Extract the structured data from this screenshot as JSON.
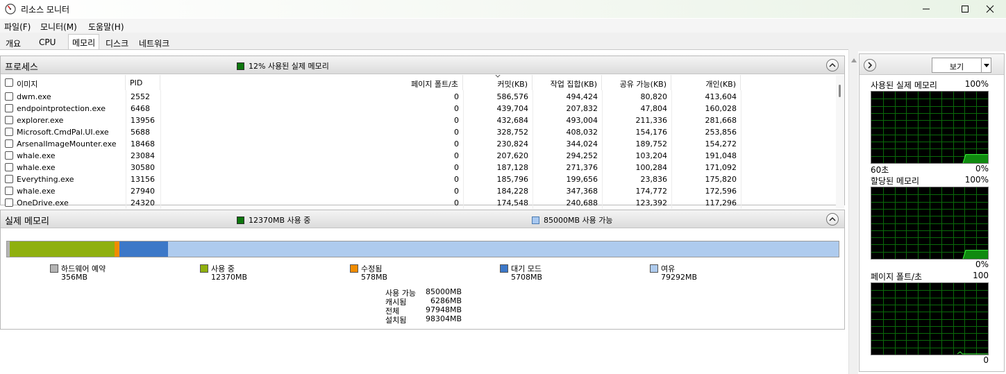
{
  "window": {
    "title": "리소스 모니터",
    "controls": {
      "minimize": "minimize-icon",
      "maximize": "maximize-icon",
      "close": "close-icon"
    }
  },
  "menu": [
    "파일(F)",
    "모니터(M)",
    "도움말(H)"
  ],
  "tabs": [
    {
      "label": "개요",
      "active": false
    },
    {
      "label": "CPU",
      "active": false
    },
    {
      "label": "메모리",
      "active": true
    },
    {
      "label": "디스크",
      "active": false
    },
    {
      "label": "네트워크",
      "active": false
    }
  ],
  "processes": {
    "title": "프로세스",
    "stat": "12% 사용된 실제 메모리",
    "columns": [
      "이미지",
      "PID",
      "페이지 폴트/초",
      "커밋(KB)",
      "작업 집합(KB)",
      "공유 가능(KB)",
      "개인(KB)"
    ],
    "rows": [
      [
        "dwm.exe",
        "2552",
        "0",
        "586,576",
        "494,424",
        "80,820",
        "413,604"
      ],
      [
        "endpointprotection.exe",
        "6468",
        "0",
        "439,704",
        "207,832",
        "47,804",
        "160,028"
      ],
      [
        "explorer.exe",
        "13956",
        "0",
        "432,684",
        "493,004",
        "211,336",
        "281,668"
      ],
      [
        "Microsoft.CmdPal.UI.exe",
        "5688",
        "0",
        "328,752",
        "408,032",
        "154,176",
        "253,856"
      ],
      [
        "ArsenalImageMounter.exe",
        "18468",
        "0",
        "230,824",
        "344,024",
        "189,752",
        "154,272"
      ],
      [
        "whale.exe",
        "23084",
        "0",
        "207,620",
        "294,252",
        "103,204",
        "191,048"
      ],
      [
        "whale.exe",
        "30580",
        "0",
        "187,128",
        "271,376",
        "100,284",
        "171,092"
      ],
      [
        "Everything.exe",
        "13156",
        "0",
        "185,796",
        "199,656",
        "23,836",
        "175,820"
      ],
      [
        "whale.exe",
        "27940",
        "0",
        "184,228",
        "347,368",
        "174,772",
        "172,596"
      ],
      [
        "OneDrive.exe",
        "24320",
        "0",
        "174,548",
        "240,688",
        "123,392",
        "117,296"
      ]
    ]
  },
  "physical_memory": {
    "title": "실제 메모리",
    "stat_in_use": "12370MB 사용 중",
    "stat_available": "85000MB 사용 가능",
    "legend": [
      {
        "name": "하드웨어 예약",
        "value": "356MB",
        "color": "#b4b4b4"
      },
      {
        "name": "사용 중",
        "value": "12370MB",
        "color": "#8fb00f"
      },
      {
        "name": "수정됨",
        "value": "578MB",
        "color": "#f08c00"
      },
      {
        "name": "대기 모드",
        "value": "5708MB",
        "color": "#3c78c8"
      },
      {
        "name": "여유",
        "value": "79292MB",
        "color": "#aecbee"
      }
    ],
    "bar_mb": [
      356,
      12370,
      578,
      5708,
      79292
    ],
    "summary": [
      {
        "label": "사용 가능",
        "value": "85000MB"
      },
      {
        "label": "캐시됨",
        "value": "6286MB"
      },
      {
        "label": "전체",
        "value": "97948MB"
      },
      {
        "label": "설치됨",
        "value": "98304MB"
      }
    ]
  },
  "right_pane": {
    "view_label": "보기",
    "graphs": [
      {
        "title": "사용된 실제 메모리",
        "max": "100%",
        "foot_left": "60초",
        "foot_right": "0%",
        "recent_level": 0.12
      },
      {
        "title": "할당된 메모리",
        "max": "100%",
        "foot_left": "",
        "foot_right": "0%",
        "recent_level": 0.12
      },
      {
        "title": "페이지 폴트/초",
        "max": "100",
        "foot_left": "",
        "foot_right": "0",
        "recent_level": 0.02
      }
    ]
  }
}
